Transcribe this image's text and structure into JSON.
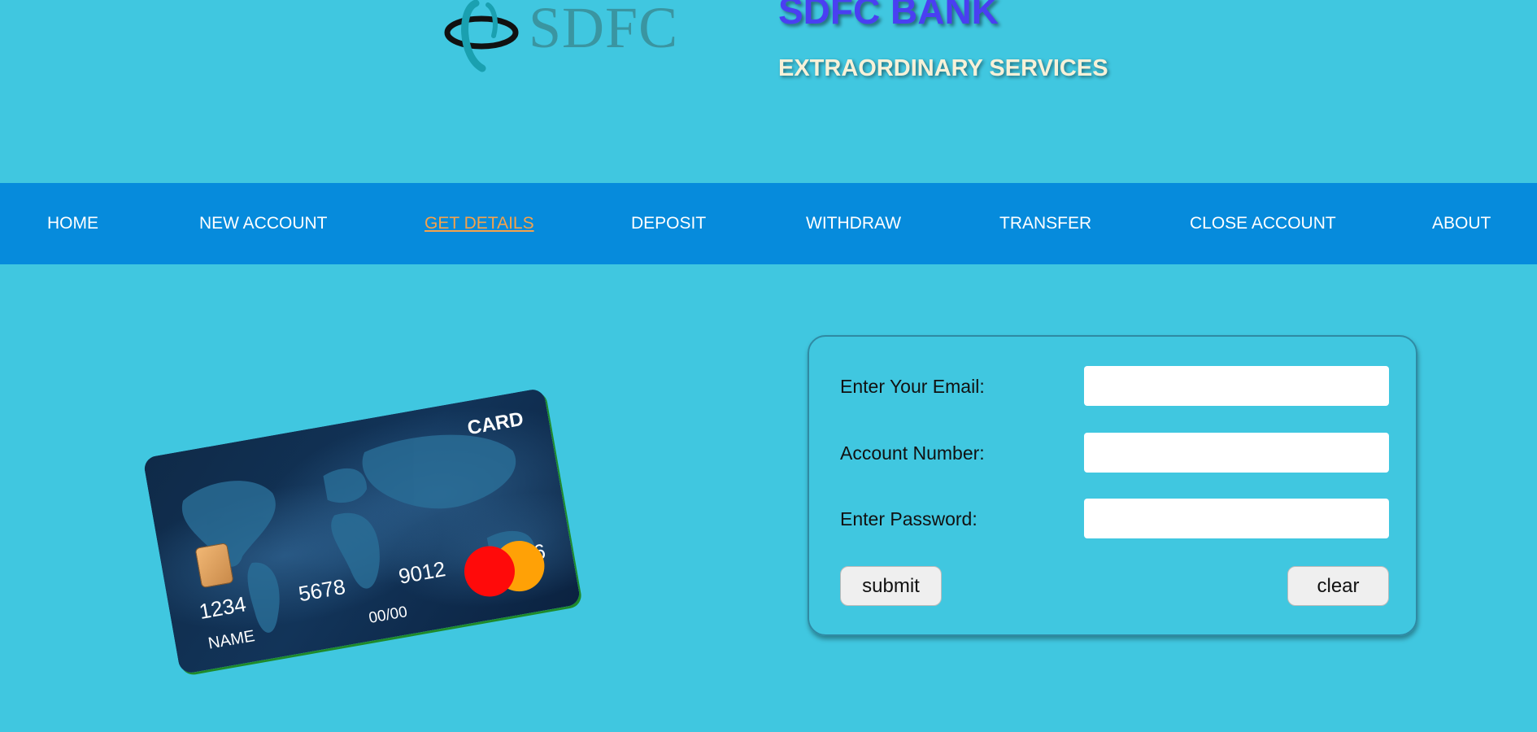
{
  "header": {
    "logo_text": "SDFC",
    "bank_name": "SDFC BANK",
    "tagline": "EXTRAORDINARY SERVICES"
  },
  "nav": {
    "items": [
      {
        "label": "HOME"
      },
      {
        "label": "NEW ACCOUNT"
      },
      {
        "label": "GET DETAILS",
        "active": true
      },
      {
        "label": "DEPOSIT"
      },
      {
        "label": "WITHDRAW"
      },
      {
        "label": "TRANSFER"
      },
      {
        "label": "CLOSE ACCOUNT"
      },
      {
        "label": "ABOUT"
      }
    ]
  },
  "card": {
    "label": "CARD",
    "numbers": [
      "1234",
      "5678",
      "9012",
      "3456"
    ],
    "name": "NAME",
    "expiry": "00/00",
    "icons": [
      "chip-icon",
      "card-network-logo"
    ]
  },
  "form": {
    "fields": [
      {
        "label": "Enter Your Email:",
        "value": "",
        "placeholder": ""
      },
      {
        "label": "Account Number:",
        "value": "",
        "placeholder": ""
      },
      {
        "label": "Enter Password:",
        "value": "",
        "placeholder": ""
      }
    ],
    "submit_label": "submit",
    "clear_label": "clear"
  },
  "colors": {
    "page_background": "#40c7e0",
    "nav_background": "#068bdc",
    "active_nav": "#f6a24a",
    "bank_name": "#4a3ff2",
    "tagline": "#f7f1d8"
  }
}
